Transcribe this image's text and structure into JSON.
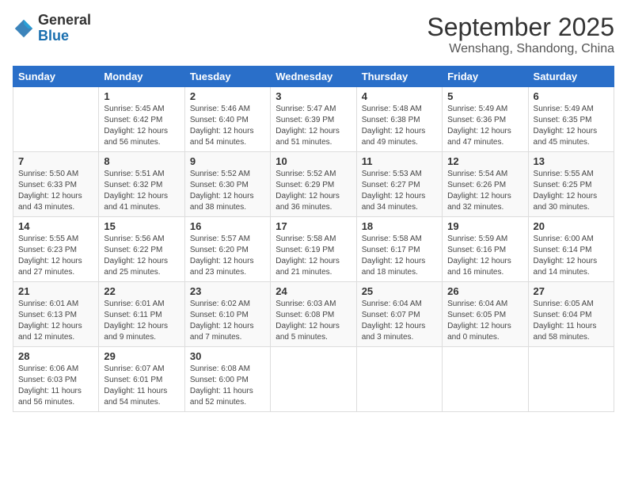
{
  "logo": {
    "general": "General",
    "blue": "Blue"
  },
  "header": {
    "month": "September 2025",
    "location": "Wenshang, Shandong, China"
  },
  "weekdays": [
    "Sunday",
    "Monday",
    "Tuesday",
    "Wednesday",
    "Thursday",
    "Friday",
    "Saturday"
  ],
  "weeks": [
    [
      {
        "day": "",
        "info": ""
      },
      {
        "day": "1",
        "info": "Sunrise: 5:45 AM\nSunset: 6:42 PM\nDaylight: 12 hours\nand 56 minutes."
      },
      {
        "day": "2",
        "info": "Sunrise: 5:46 AM\nSunset: 6:40 PM\nDaylight: 12 hours\nand 54 minutes."
      },
      {
        "day": "3",
        "info": "Sunrise: 5:47 AM\nSunset: 6:39 PM\nDaylight: 12 hours\nand 51 minutes."
      },
      {
        "day": "4",
        "info": "Sunrise: 5:48 AM\nSunset: 6:38 PM\nDaylight: 12 hours\nand 49 minutes."
      },
      {
        "day": "5",
        "info": "Sunrise: 5:49 AM\nSunset: 6:36 PM\nDaylight: 12 hours\nand 47 minutes."
      },
      {
        "day": "6",
        "info": "Sunrise: 5:49 AM\nSunset: 6:35 PM\nDaylight: 12 hours\nand 45 minutes."
      }
    ],
    [
      {
        "day": "7",
        "info": "Sunrise: 5:50 AM\nSunset: 6:33 PM\nDaylight: 12 hours\nand 43 minutes."
      },
      {
        "day": "8",
        "info": "Sunrise: 5:51 AM\nSunset: 6:32 PM\nDaylight: 12 hours\nand 41 minutes."
      },
      {
        "day": "9",
        "info": "Sunrise: 5:52 AM\nSunset: 6:30 PM\nDaylight: 12 hours\nand 38 minutes."
      },
      {
        "day": "10",
        "info": "Sunrise: 5:52 AM\nSunset: 6:29 PM\nDaylight: 12 hours\nand 36 minutes."
      },
      {
        "day": "11",
        "info": "Sunrise: 5:53 AM\nSunset: 6:27 PM\nDaylight: 12 hours\nand 34 minutes."
      },
      {
        "day": "12",
        "info": "Sunrise: 5:54 AM\nSunset: 6:26 PM\nDaylight: 12 hours\nand 32 minutes."
      },
      {
        "day": "13",
        "info": "Sunrise: 5:55 AM\nSunset: 6:25 PM\nDaylight: 12 hours\nand 30 minutes."
      }
    ],
    [
      {
        "day": "14",
        "info": "Sunrise: 5:55 AM\nSunset: 6:23 PM\nDaylight: 12 hours\nand 27 minutes."
      },
      {
        "day": "15",
        "info": "Sunrise: 5:56 AM\nSunset: 6:22 PM\nDaylight: 12 hours\nand 25 minutes."
      },
      {
        "day": "16",
        "info": "Sunrise: 5:57 AM\nSunset: 6:20 PM\nDaylight: 12 hours\nand 23 minutes."
      },
      {
        "day": "17",
        "info": "Sunrise: 5:58 AM\nSunset: 6:19 PM\nDaylight: 12 hours\nand 21 minutes."
      },
      {
        "day": "18",
        "info": "Sunrise: 5:58 AM\nSunset: 6:17 PM\nDaylight: 12 hours\nand 18 minutes."
      },
      {
        "day": "19",
        "info": "Sunrise: 5:59 AM\nSunset: 6:16 PM\nDaylight: 12 hours\nand 16 minutes."
      },
      {
        "day": "20",
        "info": "Sunrise: 6:00 AM\nSunset: 6:14 PM\nDaylight: 12 hours\nand 14 minutes."
      }
    ],
    [
      {
        "day": "21",
        "info": "Sunrise: 6:01 AM\nSunset: 6:13 PM\nDaylight: 12 hours\nand 12 minutes."
      },
      {
        "day": "22",
        "info": "Sunrise: 6:01 AM\nSunset: 6:11 PM\nDaylight: 12 hours\nand 9 minutes."
      },
      {
        "day": "23",
        "info": "Sunrise: 6:02 AM\nSunset: 6:10 PM\nDaylight: 12 hours\nand 7 minutes."
      },
      {
        "day": "24",
        "info": "Sunrise: 6:03 AM\nSunset: 6:08 PM\nDaylight: 12 hours\nand 5 minutes."
      },
      {
        "day": "25",
        "info": "Sunrise: 6:04 AM\nSunset: 6:07 PM\nDaylight: 12 hours\nand 3 minutes."
      },
      {
        "day": "26",
        "info": "Sunrise: 6:04 AM\nSunset: 6:05 PM\nDaylight: 12 hours\nand 0 minutes."
      },
      {
        "day": "27",
        "info": "Sunrise: 6:05 AM\nSunset: 6:04 PM\nDaylight: 11 hours\nand 58 minutes."
      }
    ],
    [
      {
        "day": "28",
        "info": "Sunrise: 6:06 AM\nSunset: 6:03 PM\nDaylight: 11 hours\nand 56 minutes."
      },
      {
        "day": "29",
        "info": "Sunrise: 6:07 AM\nSunset: 6:01 PM\nDaylight: 11 hours\nand 54 minutes."
      },
      {
        "day": "30",
        "info": "Sunrise: 6:08 AM\nSunset: 6:00 PM\nDaylight: 11 hours\nand 52 minutes."
      },
      {
        "day": "",
        "info": ""
      },
      {
        "day": "",
        "info": ""
      },
      {
        "day": "",
        "info": ""
      },
      {
        "day": "",
        "info": ""
      }
    ]
  ]
}
